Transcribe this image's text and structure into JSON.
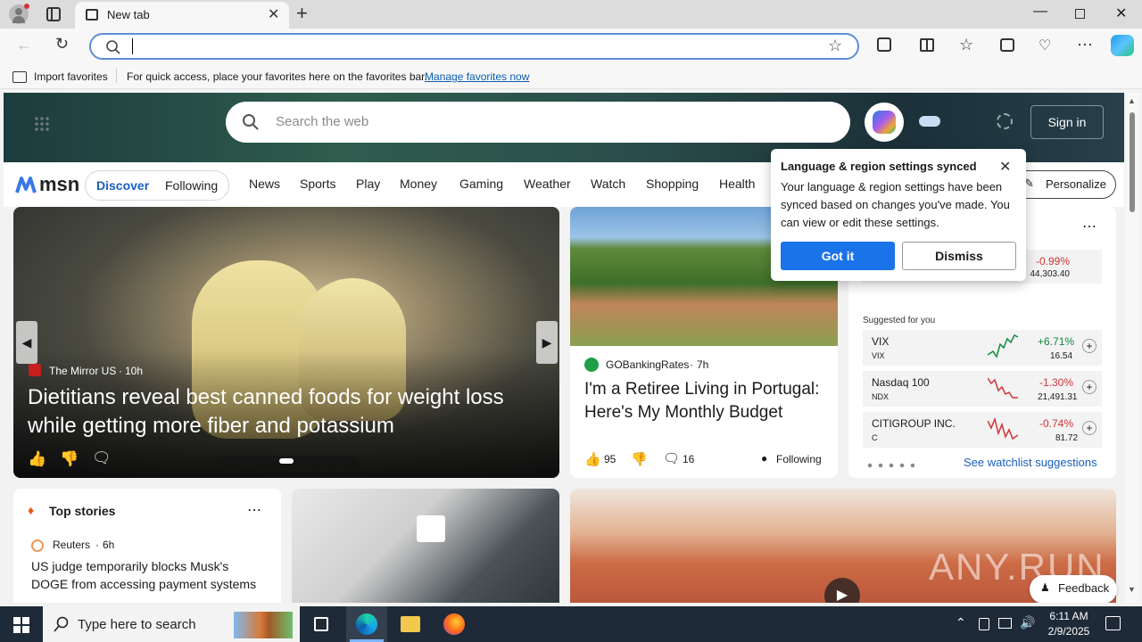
{
  "browser": {
    "tab_title": "New tab",
    "address_value": "",
    "fav_import": "Import favorites",
    "fav_message": "For quick access, place your favorites here on the favorites bar.",
    "fav_manage": "Manage favorites now"
  },
  "msn": {
    "search_placeholder": "Search the web",
    "sign_in": "Sign in",
    "logo": "msn",
    "tabs": [
      "Discover",
      "Following"
    ],
    "nav": [
      "News",
      "Sports",
      "Play",
      "Money",
      "Gaming",
      "Weather",
      "Watch",
      "Shopping",
      "Health"
    ],
    "personalize": "Personalize"
  },
  "popup": {
    "title": "Language & region settings synced",
    "body": "Your language & region settings have been synced based on changes you've made. You can view or edit these settings.",
    "got_it": "Got it",
    "dismiss": "Dismiss"
  },
  "hero": {
    "source": "The Mirror US",
    "age": "10h",
    "headline": "Dietitians reveal best canned foods for weight loss while getting more fiber and potassium"
  },
  "card2": {
    "source": "GOBankingRates",
    "age": "7h",
    "headline": "I'm a Retiree Living in Portugal: Here's My Monthly Budget",
    "likes": "95",
    "comments": "16",
    "following": "Following"
  },
  "watchlist": {
    "top": {
      "change": "-0.99%",
      "value": "44,303.40"
    },
    "suggested_label": "Suggested for you",
    "items": [
      {
        "name": "VIX",
        "symbol": "VIX",
        "change": "+6.71%",
        "value": "16.54"
      },
      {
        "name": "Nasdaq 100",
        "symbol": "NDX",
        "change": "-1.30%",
        "value": "21,491.31"
      },
      {
        "name": "CITIGROUP INC.",
        "symbol": "C",
        "change": "-0.74%",
        "value": "81.72"
      }
    ],
    "see_more": "See watchlist suggestions",
    "colors": {
      "up": "#0e8a3e",
      "down": "#d13438"
    }
  },
  "top_stories": {
    "title": "Top stories",
    "source": "Reuters",
    "age": "6h",
    "headline": "US judge temporarily blocks Musk's DOGE from accessing payment systems"
  },
  "feedback": "Feedback",
  "watermark": "ANY.RUN",
  "taskbar": {
    "search_placeholder": "Type here to search",
    "time": "6:11 AM",
    "date": "2/9/2025"
  }
}
